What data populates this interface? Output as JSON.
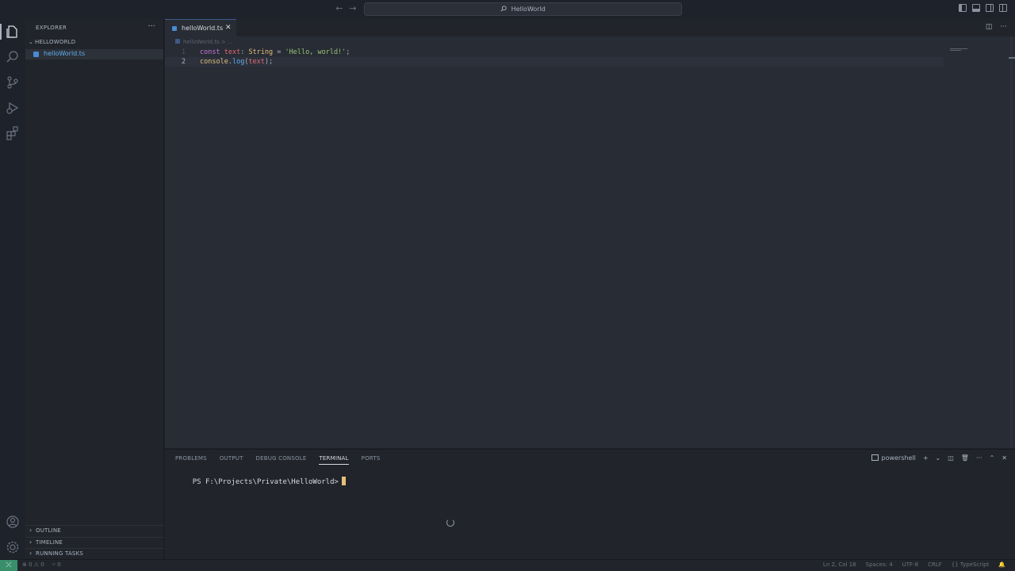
{
  "titlebar": {
    "back_icon": "arrow-left-icon",
    "forward_icon": "arrow-right-icon",
    "search_text": "HelloWorld"
  },
  "sidebar": {
    "title": "EXPLORER",
    "more": "···",
    "folder": "HELLOWORLD",
    "file": "helloWorld.ts",
    "sections": [
      "OUTLINE",
      "TIMELINE",
      "RUNNING TASKS"
    ]
  },
  "editor": {
    "tab_name": "helloWorld.ts",
    "tab_close": "✕",
    "breadcrumb": "helloWorld.ts > ...",
    "lines": [
      {
        "number": "1",
        "tokens": [
          "const",
          " ",
          "text",
          ": ",
          "String",
          " = ",
          "'Hello, world!'",
          ";"
        ]
      },
      {
        "number": "2",
        "tokens": [
          "console",
          ".",
          "log",
          "(",
          "text",
          ");"
        ]
      }
    ]
  },
  "panel": {
    "tabs": [
      "PROBLEMS",
      "OUTPUT",
      "DEBUG CONSOLE",
      "TERMINAL",
      "PORTS"
    ],
    "active_tab": "TERMINAL",
    "shell": "powershell",
    "prompt": "PS F:\\Projects\\Private\\HelloWorld>"
  },
  "statusbar": {
    "errors": "0",
    "warnings": "0",
    "ports": "0",
    "position": "Ln 2, Col 18",
    "spaces": "Spaces: 4",
    "encoding": "UTF-8",
    "eol": "CRLF",
    "language": "TypeScript"
  },
  "colors": {
    "background": "#1e222a",
    "editor_bg": "#282c34",
    "accent": "#61afef",
    "remote": "#3a8f6b"
  }
}
